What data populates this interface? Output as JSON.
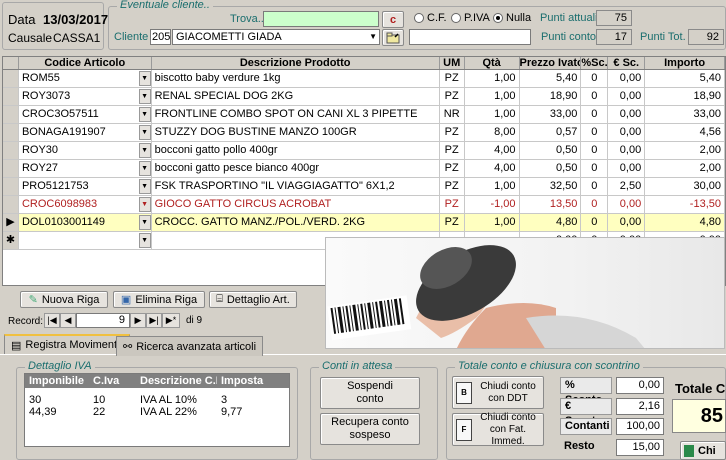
{
  "header": {
    "data_label": "Data",
    "data_value": "13/03/2017",
    "causale_label": "Causale",
    "causale_value": "CASSA1",
    "eventuale_cliente": "Eventuale cliente..",
    "trova_label": "Trova..",
    "trova_value": "",
    "c_button": "c",
    "radio_cf": "C.F.",
    "radio_piva": "P.IVA",
    "radio_nulla": "Nulla",
    "cliente_label": "Cliente",
    "cliente_code": "205",
    "cliente_name": "GIACOMETTI GIADA",
    "punti_attuali_label": "Punti attuali",
    "punti_attuali": "75",
    "punti_conto_label": "Punti conto",
    "punti_conto": "17",
    "punti_tot_label": "Punti Tot.",
    "punti_tot": "92"
  },
  "grid": {
    "columns": [
      "Codice Articolo",
      "Descrizione Prodotto",
      "UM",
      "Qtà",
      "Prezzo Ivato",
      "%Sc.",
      "€ Sc.",
      "Importo"
    ],
    "rows": [
      {
        "code": "ROM55",
        "desc": "biscotto baby verdure 1kg",
        "um": "PZ",
        "qty": "1,00",
        "price": "5,40",
        "psc": "0",
        "esc": "0,00",
        "imp": "5,40"
      },
      {
        "code": "ROY3073",
        "desc": "RENAL SPECIAL DOG 2KG",
        "um": "PZ",
        "qty": "1,00",
        "price": "18,90",
        "psc": "0",
        "esc": "0,00",
        "imp": "18,90"
      },
      {
        "code": "CROC3O57511",
        "desc": "FRONTLINE COMBO SPOT ON CANI XL 3 PIPETTE",
        "um": "NR",
        "qty": "1,00",
        "price": "33,00",
        "psc": "0",
        "esc": "0,00",
        "imp": "33,00"
      },
      {
        "code": "BONAGA191907",
        "desc": "STUZZY DOG BUSTINE MANZO 100GR",
        "um": "PZ",
        "qty": "8,00",
        "price": "0,57",
        "psc": "0",
        "esc": "0,00",
        "imp": "4,56"
      },
      {
        "code": "ROY30",
        "desc": "bocconi gatto pollo 400gr",
        "um": "PZ",
        "qty": "4,00",
        "price": "0,50",
        "psc": "0",
        "esc": "0,00",
        "imp": "2,00"
      },
      {
        "code": "ROY27",
        "desc": "bocconi gatto pesce bianco 400gr",
        "um": "PZ",
        "qty": "4,00",
        "price": "0,50",
        "psc": "0",
        "esc": "0,00",
        "imp": "2,00"
      },
      {
        "code": "PRO5121753",
        "desc": "FSK TRASPORTINO \"IL VIAGGIAGATTO\" 6X1,2",
        "um": "PZ",
        "qty": "1,00",
        "price": "32,50",
        "psc": "0",
        "esc": "2,50",
        "imp": "30,00"
      },
      {
        "code": "CROC6098983",
        "desc": "GIOCO GATTO CIRCUS ACROBAT",
        "um": "PZ",
        "qty": "-1,00",
        "price": "13,50",
        "psc": "0",
        "esc": "0,00",
        "imp": "-13,50"
      },
      {
        "code": "DOL0103001149",
        "desc": "CROCC. GATTO MANZ./POL./VERD. 2KG",
        "um": "PZ",
        "qty": "1,00",
        "price": "4,80",
        "psc": "0",
        "esc": "0,00",
        "imp": "4,80"
      },
      {
        "code": "",
        "desc": "",
        "um": "",
        "qty": "",
        "price": "0,00",
        "psc": "0",
        "esc": "0,00",
        "imp": "0,00"
      }
    ]
  },
  "toolbar": {
    "nuova_riga": "Nuova Riga",
    "elimina_riga": "Elimina Riga",
    "dettaglio_art": "Dettaglio Art."
  },
  "nav": {
    "record_label": "Record:",
    "current": "9",
    "of": "di 9"
  },
  "tabs": {
    "registra": "Registra Movimento",
    "ricerca": "Ricerca avanzata articoli"
  },
  "iva": {
    "title": "Dettaglio IVA",
    "headers": [
      "Imponibile",
      "C.Iva",
      "Descrizione C.Iva",
      "Imposta"
    ],
    "rows": [
      [
        "30",
        "10",
        "IVA AL 10%",
        "3"
      ],
      [
        "44,39",
        "22",
        "IVA AL 22%",
        "9,77"
      ]
    ]
  },
  "conti": {
    "title": "Conti in attesa",
    "sospendi": "Sospendi conto",
    "recupera": "Recupera conto sospeso"
  },
  "totale": {
    "title": "Totale conto e chiusura con scontrino",
    "chiudi_ddt": "Chiudi conto con DDT",
    "chiudi_fat": "Chiudi conto con Fat. Immed.",
    "sconto_pct_label": "% Sconto",
    "sconto_pct": "0,00",
    "sconto_eur_label": "€ Sconto",
    "sconto_eur": "2,16",
    "contanti_label": "Contanti",
    "contanti": "100,00",
    "resto_label": "Resto",
    "resto": "15,00",
    "totale_label": "Totale Co",
    "totale_value": "85",
    "chiudi_label": "Chi"
  },
  "colors": {
    "trova_bg": "#ccffcc",
    "selected_row": "#ffffc0",
    "section_title": "#1a6e6e"
  }
}
